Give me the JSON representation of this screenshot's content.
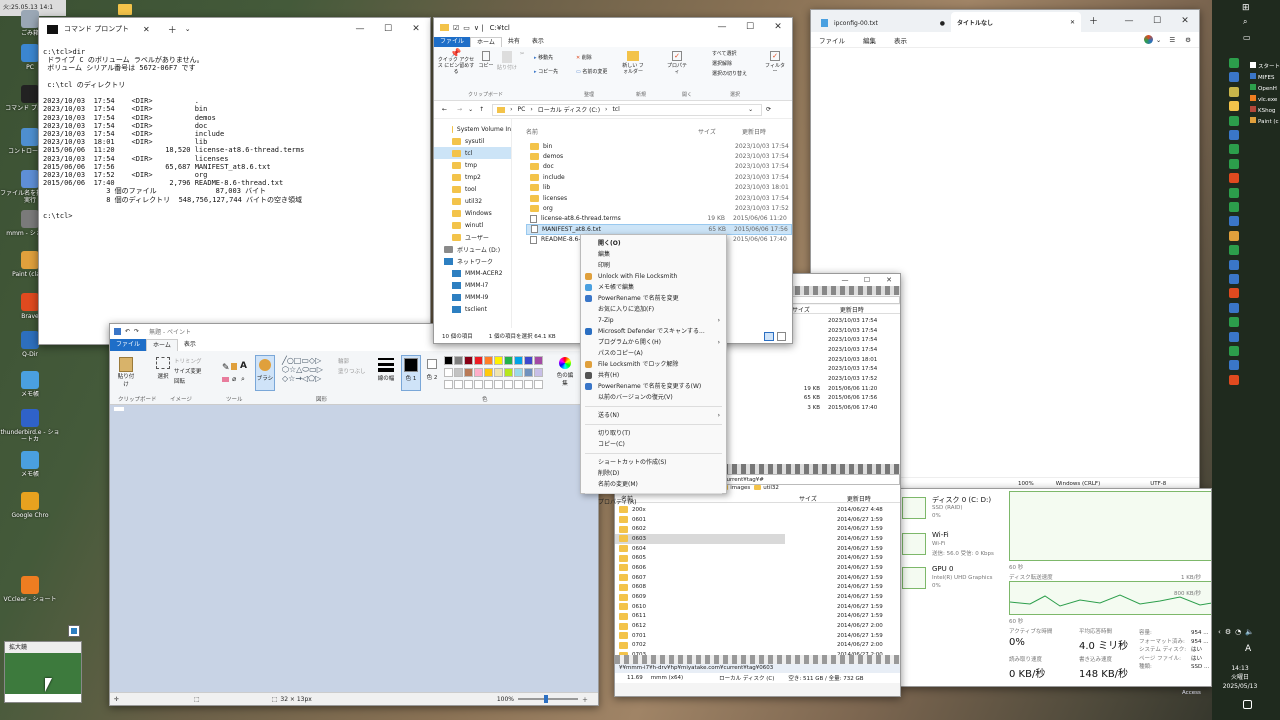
{
  "top_strip": {
    "label": "火:25.05.13 14:1"
  },
  "desktop_icons": [
    {
      "label": "ごみ箱",
      "color": "#9aa7b5"
    },
    {
      "label": "PC",
      "color": "#3b86d0"
    },
    {
      "label": "コマンド プロンプ",
      "color": "#222"
    },
    {
      "label": "コントロール パ",
      "color": "#4e8fcf"
    },
    {
      "label": "ファイル名を指定して実行",
      "color": "#5e8fd6"
    },
    {
      "label": "mmm - ショート",
      "color": "#7a7a7a"
    },
    {
      "label": "Paint (classi",
      "color": "#e0a03c"
    },
    {
      "label": "Brave",
      "color": "#e04a1f"
    },
    {
      "label": "Q-Dir",
      "color": "#2d6fbd"
    },
    {
      "label": "メモ帳",
      "color": "#4aa0e0"
    },
    {
      "label": "thunderbird.e - ショートカ",
      "color": "#2f62c9"
    },
    {
      "label": "メモ帳",
      "color": "#4aa0e0"
    },
    {
      "label": "Google Chro",
      "color": "#e8a21f"
    },
    {
      "label": "VCclear - ショート",
      "color": "#ee7d21"
    }
  ],
  "magnifier": {
    "label": "拡大鏡"
  },
  "cmd": {
    "title": "コマンド プロンプト",
    "lines": [
      "c:\\tcl>dir",
      " ドライブ C のボリューム ラベルがありません。",
      " ボリューム シリアル番号は 5672-06F7 です",
      "",
      " c:\\tcl のディレクトリ",
      "",
      "2023/10/03  17:54    <DIR>          .",
      "2023/10/03  17:54    <DIR>          bin",
      "2023/10/03  17:54    <DIR>          demos",
      "2023/10/03  17:54    <DIR>          doc",
      "2023/10/03  17:54    <DIR>          include",
      "2023/10/03  18:01    <DIR>          lib",
      "2015/06/06  11:20            18,520 license-at8.6-thread.terms",
      "2023/10/03  17:54    <DIR>          licenses",
      "2015/06/06  17:56            65,687 MANIFEST_at8.6.txt",
      "2023/10/03  17:52    <DIR>          org",
      "2015/06/06  17:40             2,796 README-8.6-thread.txt",
      "               3 個のファイル              87,003 バイト",
      "               8 個のディレクトリ  548,756,127,744 バイトの空き領域",
      "",
      "c:\\tcl>"
    ]
  },
  "explorer": {
    "title": "C:¥tcl",
    "tabs": [
      "ファイル",
      "ホーム",
      "共有",
      "表示"
    ],
    "ribbon": {
      "pin": "クイック アクセス にピン留めする",
      "copy": "コピー",
      "paste": "貼り付け",
      "clipboard": "クリップボード",
      "move_to": "移動先",
      "copy_to": "コピー先",
      "delete": "削除",
      "rename": "名前の変更",
      "organize": "整理",
      "new_folder": "新しい フォルダー",
      "new": "新規",
      "properties": "プロパティ",
      "open": "開く",
      "select_all": "すべて選択",
      "select_none": "選択解除",
      "invert": "選択の切り替え",
      "select": "選択",
      "filter": "フィルター"
    },
    "breadcrumb": [
      "PC",
      "ローカル ディスク (C:)",
      "tcl"
    ],
    "nav": [
      {
        "label": "System Volume In",
        "type": "folder"
      },
      {
        "label": "sysutil",
        "type": "folder"
      },
      {
        "label": "tcl",
        "type": "folder",
        "selected": true
      },
      {
        "label": "tmp",
        "type": "folder"
      },
      {
        "label": "tmp2",
        "type": "folder"
      },
      {
        "label": "tool",
        "type": "folder"
      },
      {
        "label": "util32",
        "type": "folder"
      },
      {
        "label": "Windows",
        "type": "folder"
      },
      {
        "label": "winutl",
        "type": "folder"
      },
      {
        "label": "ユーザー",
        "type": "folder"
      },
      {
        "label": "ボリューム (D:)",
        "type": "drive"
      },
      {
        "label": "ネットワーク",
        "type": "net"
      },
      {
        "label": "MMM-ACER2",
        "type": "mon"
      },
      {
        "label": "MMM-I7",
        "type": "mon"
      },
      {
        "label": "MMM-I9",
        "type": "mon"
      },
      {
        "label": "tsclient",
        "type": "mon"
      }
    ],
    "headers": [
      "名前",
      "サイズ",
      "更新日時"
    ],
    "files": [
      {
        "name": "bin",
        "size": "",
        "date": "2023/10/03 17:54",
        "type": "folder"
      },
      {
        "name": "demos",
        "size": "",
        "date": "2023/10/03 17:54",
        "type": "folder"
      },
      {
        "name": "doc",
        "size": "",
        "date": "2023/10/03 17:54",
        "type": "folder"
      },
      {
        "name": "include",
        "size": "",
        "date": "2023/10/03 17:54",
        "type": "folder"
      },
      {
        "name": "lib",
        "size": "",
        "date": "2023/10/03 18:01",
        "type": "folder"
      },
      {
        "name": "licenses",
        "size": "",
        "date": "2023/10/03 17:54",
        "type": "folder"
      },
      {
        "name": "org",
        "size": "",
        "date": "2023/10/03 17:52",
        "type": "folder"
      },
      {
        "name": "license-at8.6-thread.terms",
        "size": "19 KB",
        "date": "2015/06/06 11:20",
        "type": "file"
      },
      {
        "name": "MANIFEST_at8.6.txt",
        "size": "65 KB",
        "date": "2015/06/06 17:56",
        "type": "file",
        "selected": true
      },
      {
        "name": "README-8.6-th",
        "size": "3 KB",
        "date": "2015/06/06 17:40",
        "type": "file"
      }
    ],
    "status_items": "10 個の項目",
    "status_selected": "1 個の項目を選択  64.1 KB"
  },
  "context_menu": {
    "groups": [
      [
        {
          "label": "開く(O)",
          "bold": true
        },
        {
          "label": "編集"
        },
        {
          "label": "印刷"
        },
        {
          "label": "Unlock with File Locksmith",
          "icon": "#e0a03c"
        },
        {
          "label": "メモ帳で編集",
          "icon": "#4aa0e0"
        },
        {
          "label": "PowerRename で名前を変更",
          "icon": "#3a76c8"
        },
        {
          "label": "お気に入りに追加(F)"
        },
        {
          "label": "7-Zip",
          "sub": true
        },
        {
          "label": "Microsoft Defender でスキャンする...",
          "icon": "#2b6fc2"
        },
        {
          "label": "プログラムから開く(H)",
          "sub": true
        },
        {
          "label": "パスのコピー(A)"
        },
        {
          "label": "File Locksmith でロック解除",
          "icon": "#e0a03c"
        },
        {
          "label": "共有(H)",
          "icon": "#555"
        },
        {
          "label": "PowerRename で名前を変更する(W)",
          "icon": "#3a76c8"
        },
        {
          "label": "以前のバージョンの復元(V)"
        }
      ],
      [
        {
          "label": "送る(N)",
          "sub": true
        }
      ],
      [
        {
          "label": "切り取り(T)"
        },
        {
          "label": "コピー(C)"
        }
      ],
      [
        {
          "label": "ショートカットの作成(S)"
        },
        {
          "label": "削除(D)"
        },
        {
          "label": "名前の変更(M)"
        }
      ],
      [
        {
          "label": "プロパティ(R)"
        }
      ]
    ]
  },
  "notepad": {
    "tab1": "ipconfig-00.txt",
    "tab2": "タイトルなし",
    "menu": [
      "ファイル",
      "編集",
      "表示"
    ],
    "status": [
      "100%",
      "Windows (CRLF)",
      "UTF-8"
    ]
  },
  "paint": {
    "title": "無題 - ペイント",
    "tabs": [
      "ファイル",
      "ホーム",
      "表示"
    ],
    "groups": [
      "クリップボード",
      "イメージ",
      "ツール",
      "図形",
      "色"
    ],
    "buttons": {
      "paste": "貼り付け",
      "select": "選択",
      "trim": "トリミング",
      "resize": "サイズ変更",
      "rotate": "回転",
      "brush": "ブラシ",
      "outline": "輪郭",
      "fill": "塗りつぶし",
      "width": "線の幅",
      "color1": "色 1",
      "color2": "色 2",
      "edit_colors": "色の編集"
    },
    "palette": [
      "#000000",
      "#7f7f7f",
      "#880015",
      "#ed1c24",
      "#ff7f27",
      "#fff200",
      "#22b14c",
      "#00a2e8",
      "#3f48cc",
      "#a349a4",
      "#ffffff",
      "#c3c3c3",
      "#b97a57",
      "#ffaec9",
      "#ffc90e",
      "#efe4b0",
      "#b5e61d",
      "#99d9ea",
      "#7092be",
      "#c8bfe7"
    ],
    "status": {
      "size": "32 × 13px",
      "zoom": "100%"
    }
  },
  "qdir_top": {
    "headers": [
      "サイズ",
      "更新日時"
    ],
    "rows": [
      {
        "size": "",
        "date": "2023/10/03 17:54"
      },
      {
        "size": "",
        "date": "2023/10/03 17:54"
      },
      {
        "size": "",
        "date": "2023/10/03 17:54"
      },
      {
        "size": "",
        "date": "2023/10/03 17:54"
      },
      {
        "size": "",
        "date": "2023/10/03 18:01"
      },
      {
        "size": "",
        "date": "2023/10/03 17:54"
      },
      {
        "size": "",
        "date": "2023/10/03 17:52"
      },
      {
        "size": "19 KB",
        "date": "2015/06/06 11:20"
      },
      {
        "size": "65 KB",
        "date": "2015/06/06 17:56"
      },
      {
        "size": "3 KB",
        "date": "2015/06/06 17:40"
      }
    ]
  },
  "qdir_bottom": {
    "address": "¥¥mmm-i7¥h-drv¥hp¥miyatake.com¥current¥tag¥#",
    "crumbs": [
      "tool",
      "util32",
      "mmm",
      "tag",
      "images",
      "util32"
    ],
    "headers": [
      "名前",
      "サイズ",
      "更新日時"
    ],
    "rows": [
      {
        "name": "200x",
        "date": "2014/06/27 4:48"
      },
      {
        "name": "0601",
        "date": "2014/06/27 1:59"
      },
      {
        "name": "0602",
        "date": "2014/06/27 1:59"
      },
      {
        "name": "0603",
        "date": "2014/06/27 1:59",
        "selected": true
      },
      {
        "name": "0604",
        "date": "2014/06/27 1:59"
      },
      {
        "name": "0605",
        "date": "2014/06/27 1:59"
      },
      {
        "name": "0606",
        "date": "2014/06/27 1:59"
      },
      {
        "name": "0607",
        "date": "2014/06/27 1:59"
      },
      {
        "name": "0608",
        "date": "2014/06/27 1:59"
      },
      {
        "name": "0609",
        "date": "2014/06/27 1:59"
      },
      {
        "name": "0610",
        "date": "2014/06/27 1:59"
      },
      {
        "name": "0611",
        "date": "2014/06/27 1:59"
      },
      {
        "name": "0612",
        "date": "2014/06/27 2:00"
      },
      {
        "name": "0701",
        "date": "2014/06/27 1:59"
      },
      {
        "name": "0702",
        "date": "2014/06/27 2:00"
      },
      {
        "name": "0703",
        "date": "2014/06/27 2:00"
      }
    ],
    "footer_path": "¥¥mmm-i7¥h-drv¥hp¥miyatake.com¥current¥tag¥0603",
    "footer": [
      "11.69",
      "mmm (x64)",
      "ローカル ディスク (C)",
      "空き: 511 GB / 全量: 732 GB"
    ]
  },
  "taskmgr": {
    "items": [
      {
        "title": "ディスク 0 (C: D:)",
        "sub": "SSD (RAID)",
        "val": "0%"
      },
      {
        "title": "Wi-Fi",
        "sub": "Wi-Fi",
        "val": "送信: 56.0 受信: 0 Kbps"
      },
      {
        "title": "GPU 0",
        "sub": "Intel(R) UHD Graphics",
        "val": "0%"
      }
    ],
    "graph1_label": "60 秒",
    "graph1_right": "1 KB/秒",
    "graph2_title": "ディスク転送速度",
    "graph2_right": "800 KB/秒",
    "graph2_label": "60 秒",
    "stats": [
      {
        "label": "アクティブな時間",
        "value": "0%"
      },
      {
        "label": "平均応答時間",
        "value": "4.0 ミリ秒"
      },
      {
        "label": "読み取り速度",
        "value": "0 KB/秒"
      },
      {
        "label": "書き込み速度",
        "value": "148 KB/秒"
      }
    ],
    "props": [
      {
        "k": "容量:",
        "v": "954 ..."
      },
      {
        "k": "フォーマット済み:",
        "v": "954 ..."
      },
      {
        "k": "システム ディスク:",
        "v": "はい"
      },
      {
        "k": "ページ ファイル:",
        "v": "はい"
      },
      {
        "k": "種類:",
        "v": "SSD ..."
      }
    ]
  },
  "taskbar": {
    "tray_items": [
      {
        "label": "スタート",
        "color": "#fff"
      },
      {
        "label": "MIFES",
        "color": "#3a76c8"
      },
      {
        "label": "OpenH",
        "color": "#2c9e4b"
      },
      {
        "label": "vlc.exe",
        "color": "#ee7d21"
      },
      {
        "label": "KShog",
        "color": "#b4483a"
      },
      {
        "label": "Paint (c",
        "color": "#e0a03c"
      }
    ],
    "time": "14:13",
    "day": "火曜日",
    "date": "2025/05/13",
    "lang": "A",
    "access": "Access"
  }
}
